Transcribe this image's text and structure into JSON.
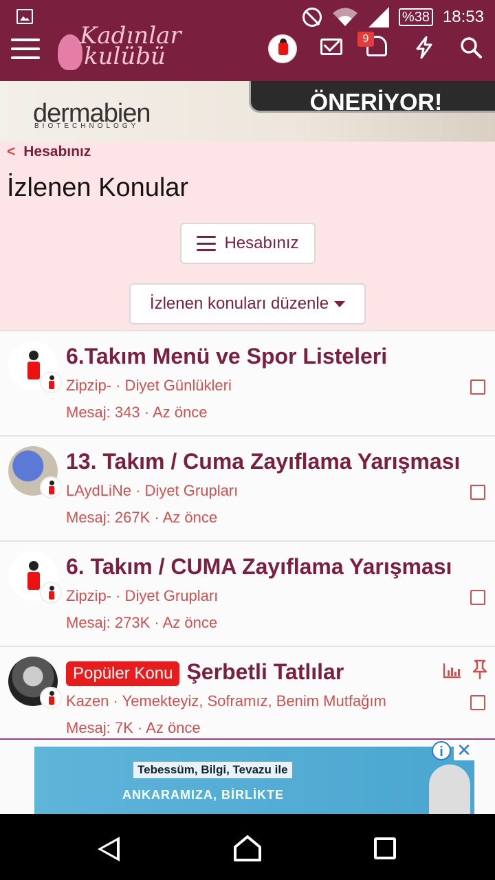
{
  "status_bar": {
    "battery": "%38",
    "time": "18:53"
  },
  "header": {
    "logo_line1": "Kadınlar",
    "logo_line2": "kulübü",
    "notification_count": "9",
    "icons": [
      "menu-icon",
      "avatar",
      "mail-icon",
      "bell-icon",
      "bolt-icon",
      "search-icon"
    ]
  },
  "banner": {
    "brand": "dermabien",
    "brand_sub": "BIOTECHNOLOGY",
    "headline": "ÖNERİYOR!"
  },
  "breadcrumb": {
    "label": "Hesabınız"
  },
  "page": {
    "title": "İzlenen Konular",
    "account_button": "Hesabınız",
    "edit_button": "İzlenen konuları düzenle"
  },
  "threads": [
    {
      "title": "6.Takım Menü ve Spor Listeleri",
      "meta": "Zipzip- · Diyet Günlükleri",
      "stats": "Mesaj: 343 · Az önce"
    },
    {
      "title": "13. Takım / Cuma Zayıflama Yarışması",
      "meta": "LAydLiNe · Diyet Grupları",
      "stats": "Mesaj: 267K · Az önce"
    },
    {
      "title": "6. Takım / CUMA Zayıflama Yarışması",
      "meta": "Zipzip- · Diyet Grupları",
      "stats": "Mesaj: 273K · Az önce"
    },
    {
      "badge": "Popüler Konu",
      "title": "Şerbetli Tatlılar",
      "meta": "Kazen · Yemekteyiz, Soframız, Benim Mutfağım",
      "stats": "Mesaj: 7K · Az önce"
    }
  ],
  "ad": {
    "line1": "Tebessüm, Bilgi, Tevazu ile",
    "line2": "ANKARAMIZA, BİRLİKTE",
    "info": "i",
    "close": "✕"
  },
  "colors": {
    "brand": "#7a1f3d",
    "header_bg": "#7a1f3d",
    "page_head_bg": "#fde4e6",
    "meta_red": "#d05050",
    "badge_red": "#e81c1c"
  }
}
